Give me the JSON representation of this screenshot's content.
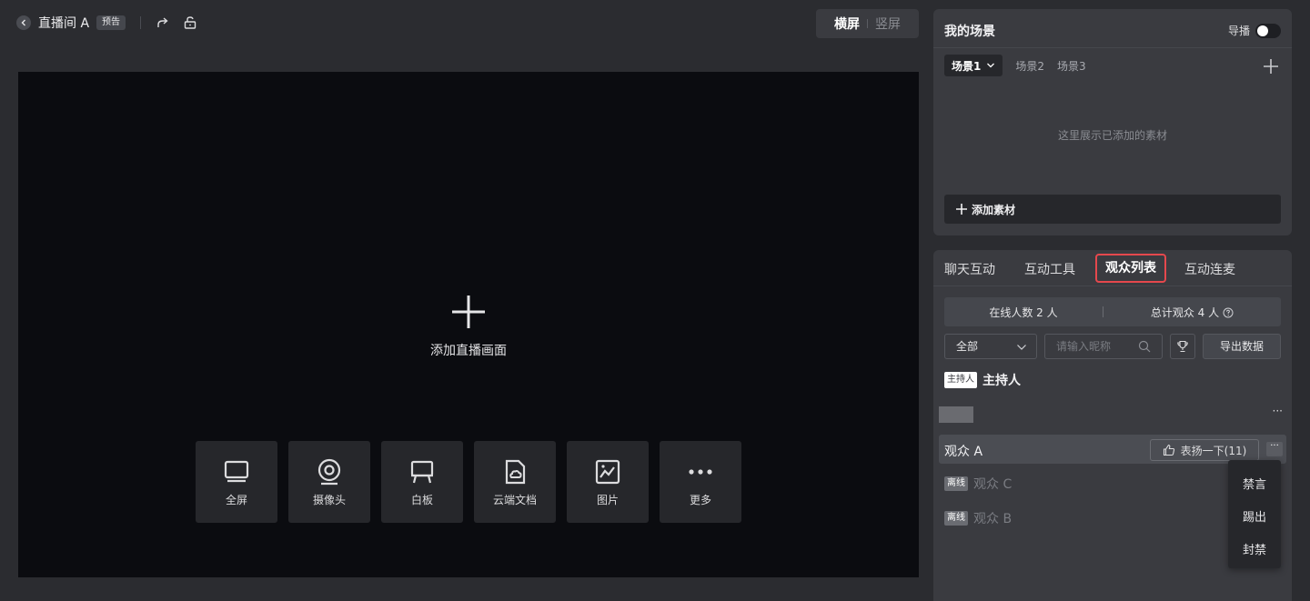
{
  "header": {
    "room_title": "直播间 A",
    "room_badge": "预告",
    "orientation": {
      "landscape": "横屏",
      "portrait": "竖屏"
    }
  },
  "stage": {
    "add_label": "添加直播画面",
    "sources": [
      {
        "label": "全屏",
        "icon": "monitor-icon"
      },
      {
        "label": "摄像头",
        "icon": "webcam-icon"
      },
      {
        "label": "白板",
        "icon": "whiteboard-icon"
      },
      {
        "label": "云端文档",
        "icon": "cloud-doc-icon"
      },
      {
        "label": "图片",
        "icon": "image-icon"
      },
      {
        "label": "更多",
        "icon": "more-dots-icon"
      }
    ]
  },
  "scene": {
    "title": "我的场景",
    "director_label": "导播",
    "director_on": false,
    "tabs": [
      "场景1",
      "场景2",
      "场景3"
    ],
    "empty_tip": "这里展示已添加的素材",
    "add_material": "添加素材"
  },
  "interact": {
    "tabs": [
      "聊天互动",
      "互动工具",
      "观众列表",
      "互动连麦"
    ],
    "active_tab": "观众列表",
    "stats": {
      "online": "在线人数 2 人",
      "total": "总计观众 4 人"
    },
    "filter": {
      "selected": "全部",
      "search_placeholder": "请输入昵称",
      "export": "导出数据"
    },
    "host": {
      "badge": "主持人",
      "name": "主持人"
    },
    "audience": [
      {
        "name": "观众 A",
        "praise": "表扬一下(11)",
        "more": "···"
      },
      {
        "name": "观众 C",
        "badge": "离线"
      },
      {
        "name": "观众 B",
        "badge": "离线"
      }
    ],
    "row_more": "···",
    "menu": [
      "禁言",
      "踢出",
      "封禁"
    ]
  },
  "colors": {
    "accent_outline": "#e5484d",
    "panel_bg": "#3a3b40",
    "stage_bg": "#0b0c10"
  }
}
